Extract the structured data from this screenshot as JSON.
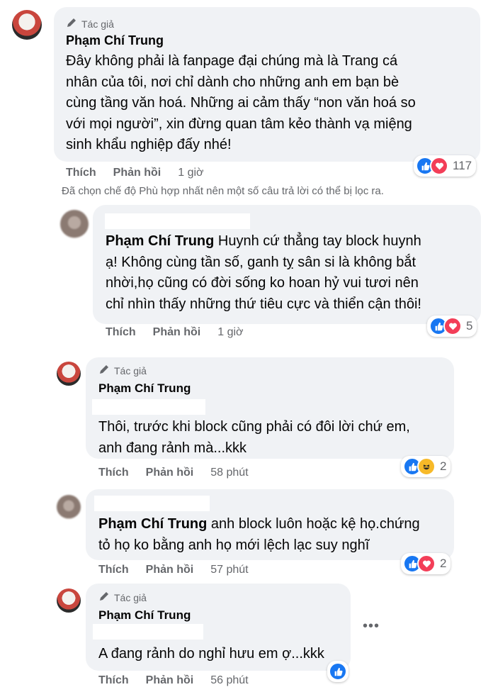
{
  "colors": {
    "bubble": "#f0f2f5",
    "muted": "#65676b",
    "like": "#1877f2",
    "love": "#f33e58",
    "haha": "#f7b928"
  },
  "filter_note": "Đã chọn chế độ Phù hợp nhất nên một số câu trả lời có thể bị lọc ra.",
  "comments": [
    {
      "author_badge": "Tác giả",
      "author_name": "Phạm Chí Trung",
      "lines": [
        "Đây không phải là fanpage đại chúng mà là Trang cá",
        "nhân của tôi, nơi chỉ dành cho những anh em bạn bè",
        "cùng tầng văn hoá. Những ai cảm thấy “non văn hoá so",
        "với mọi người”, xin đừng quan tâm kẻo thành vạ miệng",
        "sinh khẩu nghiệp đấy nhé!"
      ],
      "like_label": "Thích",
      "reply_label": "Phản hồi",
      "time": "1 giờ",
      "reactions": [
        "like-icon",
        "love-icon"
      ],
      "reaction_count": "117"
    },
    {
      "mention": "Phạm Chí Trung",
      "lines": [
        "Huynh cứ thẳng tay block huynh",
        "ạ! Không cùng tần số, ganh tỵ sân si là không bắt",
        "nhời,họ cũng có đời sống ko hoan hỷ vui tươi nên",
        "chỉ nhìn thấy những thứ tiêu cực và thiển cận thôi!"
      ],
      "like_label": "Thích",
      "reply_label": "Phản hồi",
      "time": "1 giờ",
      "reactions": [
        "like-icon",
        "love-icon"
      ],
      "reaction_count": "5"
    },
    {
      "author_badge": "Tác giả",
      "author_name": "Phạm Chí Trung",
      "lines": [
        "Thôi, trước khi block cũng phải có đôi lời chứ em,",
        "anh đang rảnh mà...kkk"
      ],
      "like_label": "Thích",
      "reply_label": "Phản hồi",
      "time": "58 phút",
      "reactions": [
        "like-icon",
        "haha-icon"
      ],
      "reaction_count": "2"
    },
    {
      "mention": "Phạm Chí Trung",
      "lines": [
        "anh block luôn hoặc kệ họ.chứng",
        "tỏ họ ko bằng anh họ mới lệch lạc suy nghĩ"
      ],
      "like_label": "Thích",
      "reply_label": "Phản hồi",
      "time": "57 phút",
      "reactions": [
        "like-icon",
        "love-icon"
      ],
      "reaction_count": "2"
    },
    {
      "author_badge": "Tác giả",
      "author_name": "Phạm Chí Trung",
      "lines": [
        "A đang rảnh do nghỉ hưu em ợ...kkk"
      ],
      "like_label": "Thích",
      "reply_label": "Phản hồi",
      "time": "56 phút",
      "reactions": [
        "like-icon"
      ],
      "reaction_count": ""
    }
  ]
}
